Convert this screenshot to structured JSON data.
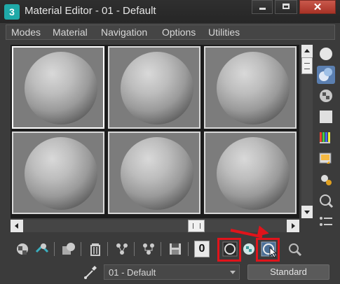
{
  "window": {
    "title": "Material Editor - 01 - Default",
    "app_icon_glyph": "3"
  },
  "title_buttons": {
    "close_glyph": "✕"
  },
  "menu": {
    "items": [
      "Modes",
      "Material",
      "Navigation",
      "Options",
      "Utilities"
    ]
  },
  "sample_slots": {
    "count": 6,
    "active_index": 0
  },
  "bottom": {
    "slot_number": "0",
    "material_name": "01 - Default",
    "material_type": "Standard"
  },
  "colors": {
    "highlight": "#e0141b",
    "accent": "#1fa9a8"
  }
}
